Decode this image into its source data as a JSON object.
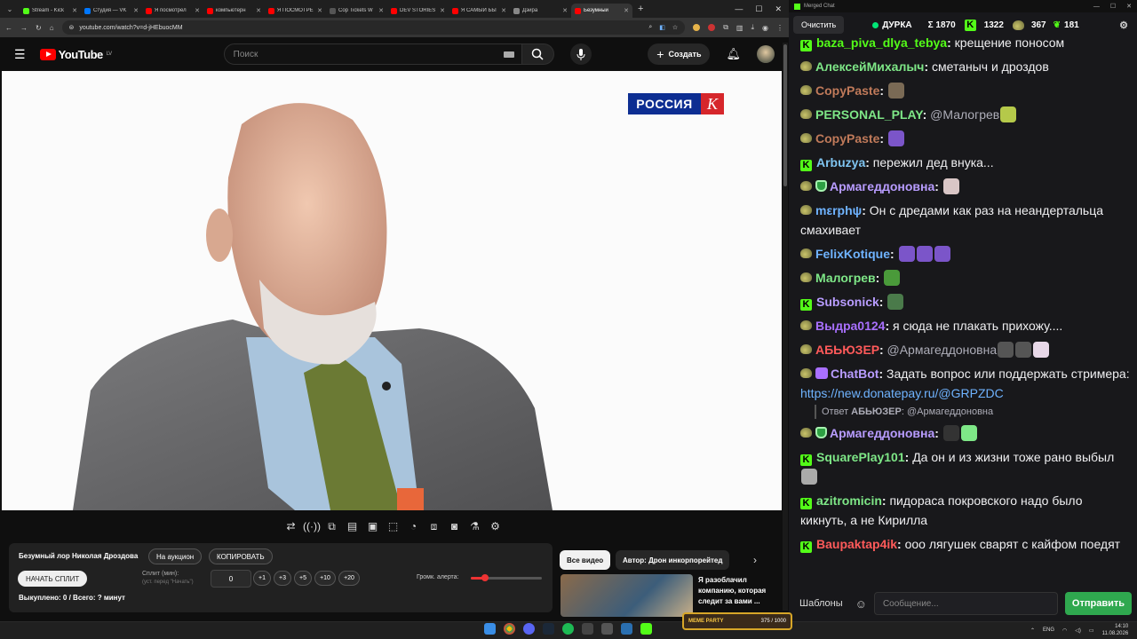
{
  "browser": {
    "tabs": [
      {
        "label": "Stream - Kick",
        "color": "#53fc18"
      },
      {
        "label": "Студия — VK",
        "color": "#0077ff"
      },
      {
        "label": "Я посмотрел",
        "color": "#ff0000"
      },
      {
        "label": "компьютерн",
        "color": "#ff0000"
      },
      {
        "label": "Я ПОСМОТРЕ",
        "color": "#ff0000"
      },
      {
        "label": "Cop Tickets W",
        "color": "#555555"
      },
      {
        "label": "DEV STORIES",
        "color": "#ff0000"
      },
      {
        "label": "Я САМЫЙ БЫ",
        "color": "#ff0000"
      },
      {
        "label": "Дэйра",
        "color": "#888888"
      },
      {
        "label": "Безумный",
        "color": "#ff0000"
      }
    ],
    "new_tab": "+",
    "url": "youtube.com/watch?v=d-jHEbuocMM"
  },
  "youtube": {
    "logo_text": "YouTube",
    "region": "LV",
    "search_placeholder": "Поиск",
    "create_label": "Создать"
  },
  "video": {
    "channel_logo_text": "РОССИЯ",
    "channel_logo_letter": "К"
  },
  "panel": {
    "title": "Безумный лор Николая Дроздова",
    "auction_btn": "На аукцион",
    "copy_btn": "КОПИРОВАТЬ",
    "start_split_btn": "НАЧАТЬ СПЛИТ",
    "split_label": "Сплит (мин):",
    "split_hint": "(уст. перед \"Начать\")",
    "split_value": "0",
    "increments": [
      "+1",
      "+3",
      "+5",
      "+10",
      "+20"
    ],
    "paid_text": "Выкуплено: 0 / Всего: ? минут",
    "volume_label": "Громк. алерта:",
    "volume_level": 0.2
  },
  "related": {
    "chip_all": "Все видео",
    "chip_author": "Автор: Дрон инкорпорейтед",
    "title": "Я разоблачил компанию, которая следит за вами ..."
  },
  "chat": {
    "window_title": "Merged Chat",
    "clear_label": "Очистить",
    "streamer": "ДУРКА",
    "total": "Σ 1870",
    "kick_count": "1322",
    "twitch_count": "367",
    "other_count": "181",
    "messages": [
      {
        "badge": "k",
        "user": "baza_piva_dlya_tebya",
        "color": "#53fc18",
        "text": "крещение поносом"
      },
      {
        "badge": "pot",
        "user": "АлексейМихалыч",
        "color": "#7ee787",
        "text": "сметаныч и дроздов"
      },
      {
        "badge": "pot",
        "user": "CopyPaste",
        "color": "#c07a5a",
        "text": "",
        "emotes": [
          "#7a6a55"
        ]
      },
      {
        "badge": "pot",
        "user": "PERSONAL_PLAY",
        "color": "#7ee787",
        "text": "",
        "mention": "@Малогрев",
        "emotes": [
          "#b5c94a"
        ]
      },
      {
        "badge": "pot",
        "user": "CopyPaste",
        "color": "#c07a5a",
        "text": "",
        "emotes": [
          "#7b55c9"
        ]
      },
      {
        "badge": "k",
        "user": "Arbuzya",
        "color": "#7fc4f0",
        "text": "пережил дед внука..."
      },
      {
        "badge": "pot-shield",
        "user": "Армагеддоновна",
        "color": "#b89cff",
        "text": "",
        "emotes": [
          "#d9c6c6"
        ]
      },
      {
        "badge": "pot",
        "user": "mεrphψ",
        "color": "#6fb3ff",
        "text": "Он с дредами как раз на неандертальца смахивает"
      },
      {
        "badge": "pot",
        "user": "FelixKotique",
        "color": "#6fb3ff",
        "text": "",
        "emotes": [
          "#7b55c9",
          "#7b55c9",
          "#7b55c9"
        ]
      },
      {
        "badge": "pot",
        "user": "Малогрев",
        "color": "#7ee787",
        "text": "",
        "emotes": [
          "#4a9a3a"
        ]
      },
      {
        "badge": "k",
        "user": "Subsonick",
        "color": "#b89cff",
        "text": "",
        "emotes": [
          "#4a7a4a"
        ]
      },
      {
        "badge": "pot",
        "user": "Выдра0124",
        "color": "#a970ff",
        "text": "я сюда не плакать прихожу...."
      },
      {
        "badge": "pot",
        "user": "АБЬЮЗЕР",
        "color": "#ff5a5a",
        "text": "",
        "mention": "@Армагеддоновна",
        "emotes": [
          "#555555",
          "#555555",
          "#e8d8e8"
        ]
      },
      {
        "badge": "pot-bot",
        "user": "ChatBot",
        "color": "#b89cff",
        "text": "Задать вопрос или поддержать стримера:",
        "link": "https://new.donatepay.ru/@GRPZDC"
      },
      {
        "badge": "pot-shield",
        "user": "Армагеддоновна",
        "color": "#b89cff",
        "text": "",
        "reply_to": "АБЬЮЗЕР",
        "reply_text": "@Армагеддоновна",
        "emotes": [
          "#333333",
          "#7ee787"
        ]
      },
      {
        "badge": "k",
        "user": "SquarePlay101",
        "color": "#7ee787",
        "text": "Да он и из жизни тоже рано выбыл",
        "emotes": [
          "#aaaaaa"
        ]
      },
      {
        "badge": "k",
        "user": "azitromicin",
        "color": "#7ee787",
        "text": "пидораса покровского надо было кикнуть, а не Кирилла"
      },
      {
        "badge": "k",
        "user": "Baupaktap4ik",
        "color": "#ff5a5a",
        "text": "ооо лягушек сварят с кайфом поедят"
      }
    ],
    "templates_label": "Шаблоны",
    "input_placeholder": "Сообщение...",
    "send_label": "Отправить"
  },
  "widget": {
    "label": "MEME PARTY",
    "value": "375 / 1000"
  },
  "taskbar": {
    "lang": "ENG",
    "time": "14:10",
    "date": "11.08.2026"
  }
}
